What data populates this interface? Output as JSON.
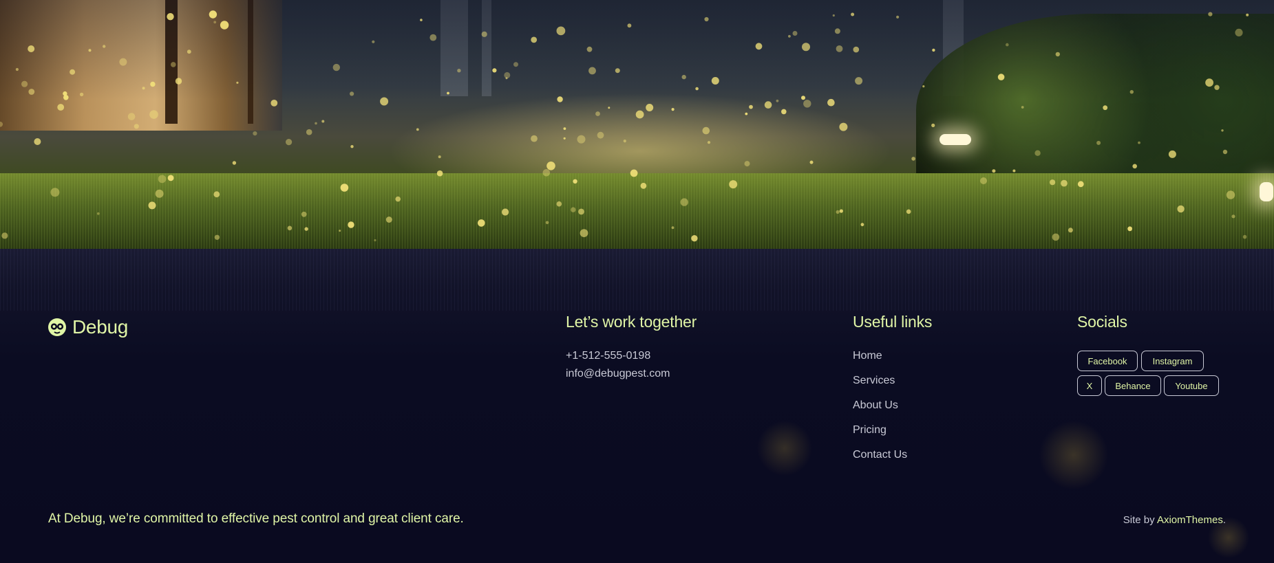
{
  "brand": {
    "name": "Debug"
  },
  "contact": {
    "title": "Let’s work together",
    "phone": "+1-512-555-0198",
    "email": "info@debugpest.com"
  },
  "useful_links": {
    "title": "Useful links",
    "items": [
      "Home",
      "Services",
      "About Us",
      "Pricing",
      "Contact Us"
    ]
  },
  "socials": {
    "title": "Socials",
    "items": [
      "Facebook",
      "Instagram",
      "X",
      "Behance",
      "Youtube"
    ]
  },
  "tagline": "At Debug, we’re committed to effective pest control and great client care.",
  "credit": {
    "prefix": "Site by ",
    "link": "AxiomThemes",
    "suffix": "."
  },
  "colors": {
    "accent": "#e0f5a6",
    "text_muted": "#c9cad6",
    "footer_bg": "#0a0a20"
  },
  "icons": {
    "logo": "bug-face-icon"
  }
}
